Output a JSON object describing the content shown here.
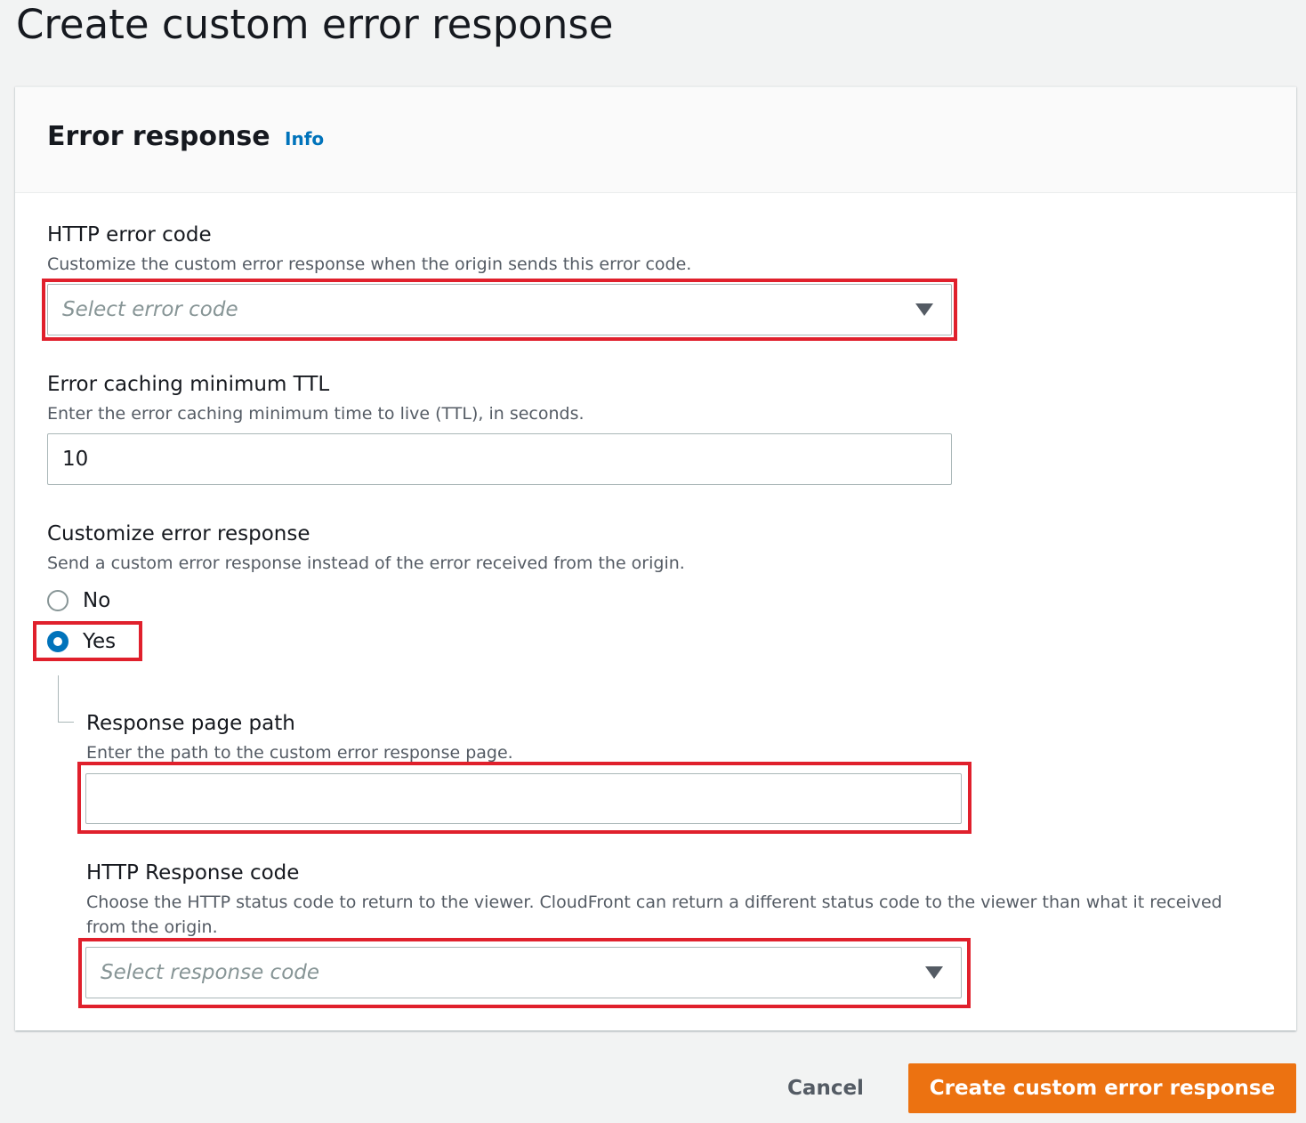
{
  "page": {
    "title": "Create custom error response"
  },
  "panel": {
    "title": "Error response",
    "info_link": "Info"
  },
  "fields": {
    "http_error_code": {
      "label": "HTTP error code",
      "description": "Customize the custom error response when the origin sends this error code.",
      "placeholder": "Select error code"
    },
    "min_ttl": {
      "label": "Error caching minimum TTL",
      "description": "Enter the error caching minimum time to live (TTL), in seconds.",
      "value": "10"
    },
    "customize": {
      "label": "Customize error response",
      "description": "Send a custom error response instead of the error received from the origin.",
      "options": [
        {
          "label": "No",
          "checked": false
        },
        {
          "label": "Yes",
          "checked": true
        }
      ]
    },
    "response_page_path": {
      "label": "Response page path",
      "description": "Enter the path to the custom error response page.",
      "value": ""
    },
    "http_response_code": {
      "label": "HTTP Response code",
      "description_line1": "Choose the HTTP status code to return to the viewer. CloudFront can return a different status code to the viewer than what it received",
      "description_line2": "from the origin.",
      "placeholder": "Select response code"
    }
  },
  "actions": {
    "cancel_label": "Cancel",
    "create_label": "Create custom error response"
  },
  "colors": {
    "primary": "#ec7211",
    "link": "#0073bb",
    "highlight": "#e0202c"
  }
}
